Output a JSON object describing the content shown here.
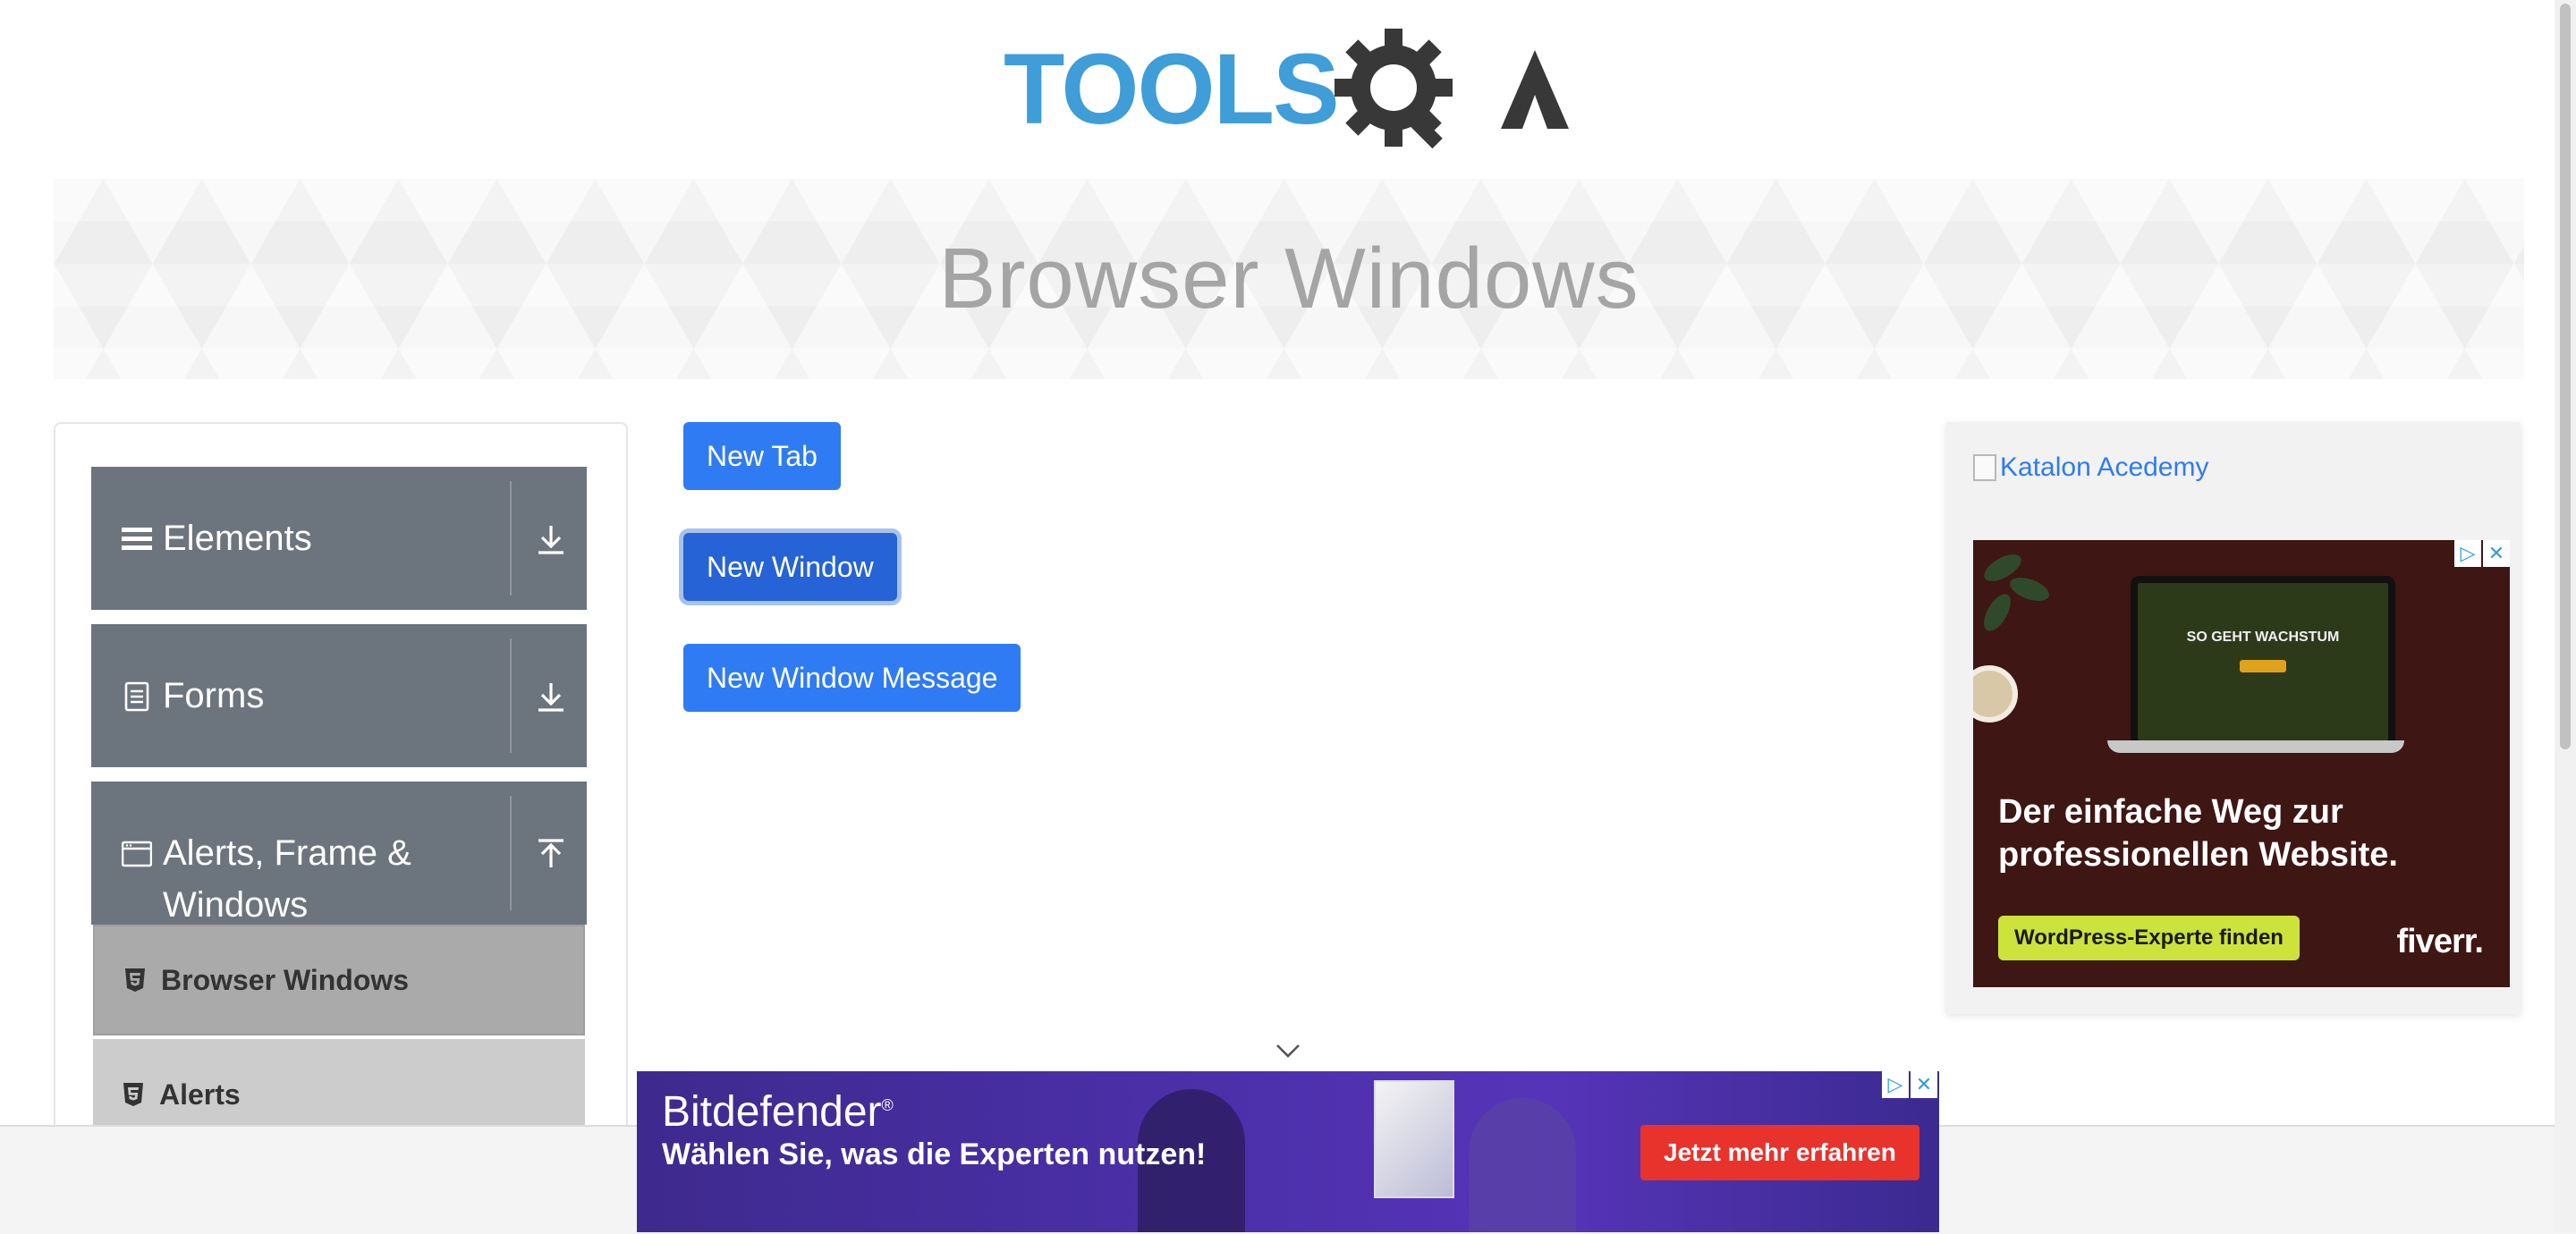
{
  "site": {
    "logo_text": "TOOLSQA"
  },
  "page": {
    "title": "Browser Windows"
  },
  "sidebar": {
    "groups": [
      {
        "label": "Elements",
        "icon": "hamburger-icon",
        "toggle": "download-arrow-icon"
      },
      {
        "label": "Forms",
        "icon": "document-icon",
        "toggle": "download-arrow-icon"
      },
      {
        "label": "Alerts, Frame &",
        "label_line2": "Windows",
        "icon": "window-icon",
        "toggle": "upload-arrow-icon"
      }
    ],
    "items": [
      {
        "label": "Browser Windows",
        "icon": "html5-icon",
        "active": true
      },
      {
        "label": "Alerts",
        "icon": "html5-icon",
        "active": false
      }
    ]
  },
  "main": {
    "buttons": {
      "new_tab": "New Tab",
      "new_window": "New Window",
      "new_window_message": "New Window Message"
    }
  },
  "right_ad": {
    "link_alt": "Katalon Acedemy",
    "screen_text": "SO GEHT WACHSTUM",
    "headline_line1": "Der einfache Weg zur",
    "headline_line2": "professionellen Website.",
    "cta": "WordPress-Experte finden",
    "brand": "fiverr."
  },
  "bottom_ad": {
    "brand": "Bitdefender",
    "trademark": "®",
    "tagline": "Wählen Sie, was die Experten nutzen!",
    "cta": "Jetzt mehr erfahren"
  },
  "colors": {
    "primary_button": "#2f7bf4",
    "sidebar_group": "#6c757d",
    "active_item": "#aaaaaa",
    "inactive_item": "#cccccc",
    "logo_blue": "#3f9dd8",
    "logo_dark": "#383838"
  }
}
